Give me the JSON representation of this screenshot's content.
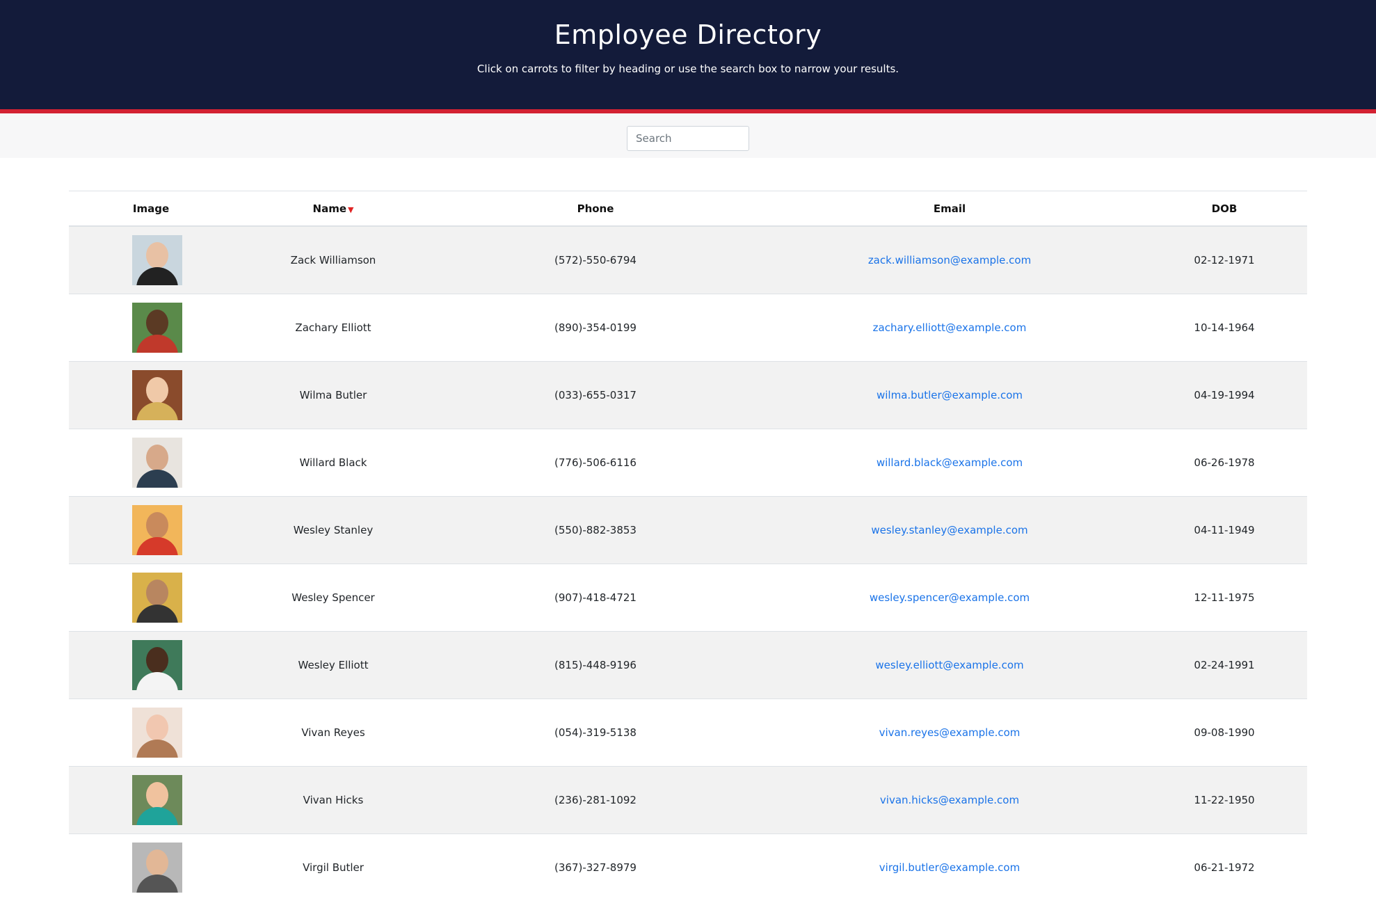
{
  "header": {
    "title": "Employee Directory",
    "subtitle": "Click on carrots to filter by heading or use the search box to narrow your results."
  },
  "search": {
    "placeholder": "Search",
    "value": ""
  },
  "table": {
    "columns": [
      "Image",
      "Name",
      "Phone",
      "Email",
      "DOB"
    ],
    "sorted_column": "Name",
    "sort_indicator": "▼",
    "rows": [
      {
        "name": "Zack Williamson",
        "phone": "(572)-550-6794",
        "email": "zack.williamson@example.com",
        "dob": "02-12-1971",
        "bg": "#c9d6de",
        "skin": "#e8c1a4",
        "shirt": "#222222"
      },
      {
        "name": "Zachary Elliott",
        "phone": "(890)-354-0199",
        "email": "zachary.elliott@example.com",
        "dob": "10-14-1964",
        "bg": "#5a8a4a",
        "skin": "#5b3a24",
        "shirt": "#c0392b"
      },
      {
        "name": "Wilma Butler",
        "phone": "(033)-655-0317",
        "email": "wilma.butler@example.com",
        "dob": "04-19-1994",
        "bg": "#8a4b2c",
        "skin": "#f0c9a8",
        "shirt": "#d6b15a"
      },
      {
        "name": "Willard Black",
        "phone": "(776)-506-6116",
        "email": "willard.black@example.com",
        "dob": "06-26-1978",
        "bg": "#e8e4df",
        "skin": "#d7a98a",
        "shirt": "#2c3e50"
      },
      {
        "name": "Wesley Stanley",
        "phone": "(550)-882-3853",
        "email": "wesley.stanley@example.com",
        "dob": "04-11-1949",
        "bg": "#f2b65a",
        "skin": "#c98a5c",
        "shirt": "#d63a2a"
      },
      {
        "name": "Wesley Spencer",
        "phone": "(907)-418-4721",
        "email": "wesley.spencer@example.com",
        "dob": "12-11-1975",
        "bg": "#d9b14a",
        "skin": "#b88660",
        "shirt": "#333333"
      },
      {
        "name": "Wesley Elliott",
        "phone": "(815)-448-9196",
        "email": "wesley.elliott@example.com",
        "dob": "02-24-1991",
        "bg": "#3f7a5a",
        "skin": "#4a2e1e",
        "shirt": "#f4f4f4"
      },
      {
        "name": "Vivan Reyes",
        "phone": "(054)-319-5138",
        "email": "vivan.reyes@example.com",
        "dob": "09-08-1990",
        "bg": "#efe1d7",
        "skin": "#f1c7b0",
        "shirt": "#b07a55"
      },
      {
        "name": "Vivan Hicks",
        "phone": "(236)-281-1092",
        "email": "vivan.hicks@example.com",
        "dob": "11-22-1950",
        "bg": "#6d8a5a",
        "skin": "#f0c29e",
        "shirt": "#1fa39a"
      },
      {
        "name": "Virgil Butler",
        "phone": "(367)-327-8979",
        "email": "virgil.butler@example.com",
        "dob": "06-21-1972",
        "bg": "#b8b8b8",
        "skin": "#e2b796",
        "shirt": "#555555"
      }
    ]
  },
  "colors": {
    "header_bg": "#131b3a",
    "header_accent": "#d32232",
    "link": "#1a73e8",
    "stripe": "#f2f2f2",
    "caret": "#e02424"
  }
}
